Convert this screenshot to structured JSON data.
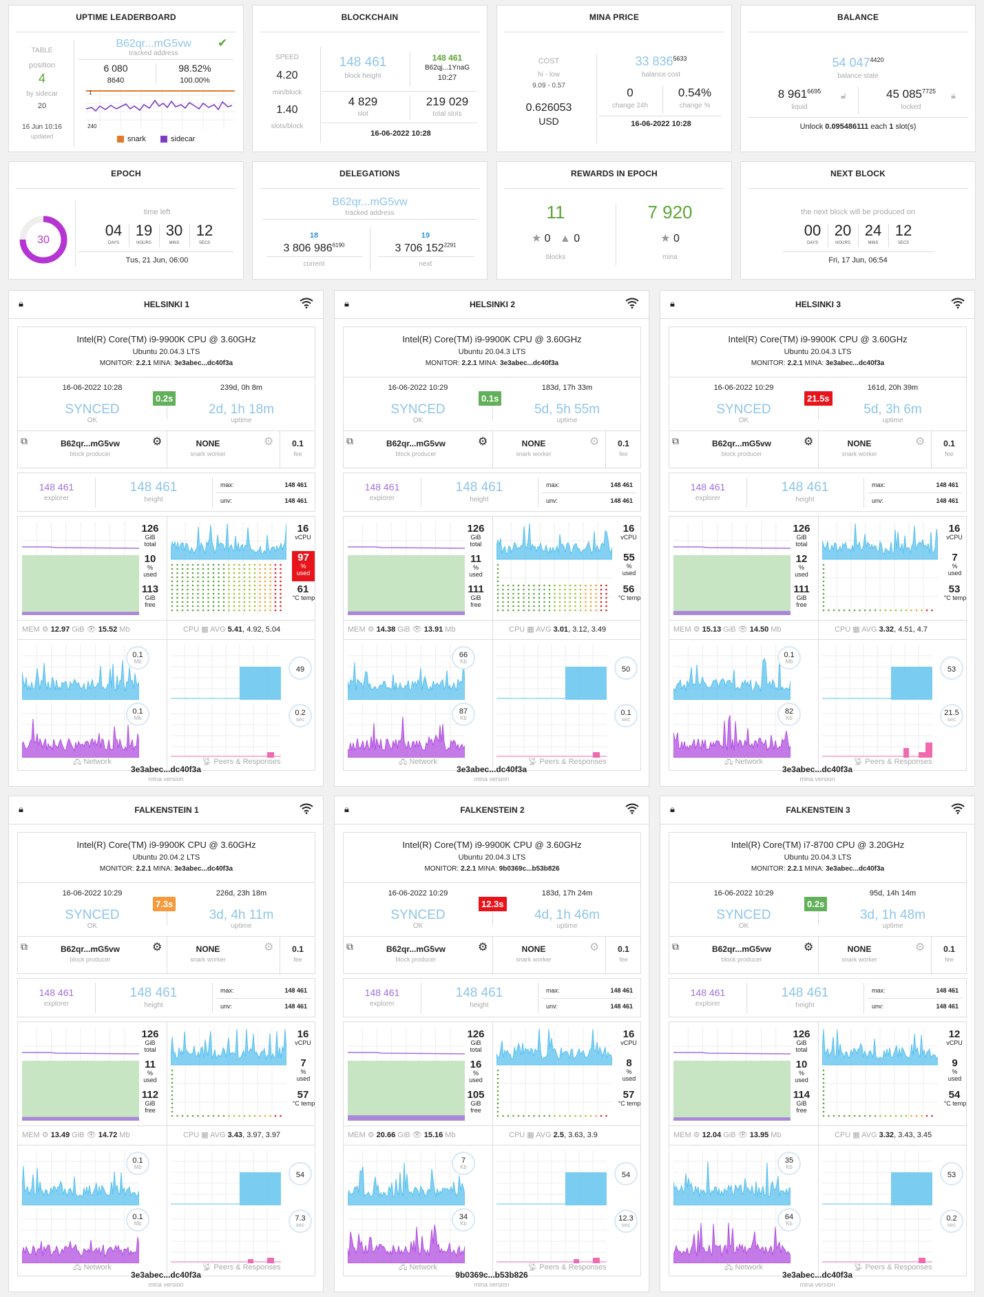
{
  "colors": {
    "accent_blue": "#8ec5ea",
    "green": "#5ba437",
    "purple": "#a36fe0",
    "red": "#e8141b",
    "orange": "#f59a3c",
    "badge_green": "#62b05a",
    "mem_fill": "#c7e5c2",
    "cpu_line": "#59c0ee"
  },
  "uptime": {
    "title": "UPTIME LEADERBOARD",
    "table_label": "TABLE",
    "position_label": "position",
    "position": "4",
    "by_sidecar_label": "by sidecar",
    "by_sidecar": "20",
    "date": "16 Jun 10:16",
    "updated_label": "updated",
    "address": "B62qr...mG5vw",
    "tracked_label": "tracked address",
    "score1": "6 080",
    "score2": "8640",
    "pct1": "98.52%",
    "pct2": "100.00%",
    "axis_top": "1",
    "axis_bottom": "240",
    "legend_snark": "snark",
    "legend_sidecar": "sidecar"
  },
  "blockchain": {
    "title": "BLOCKCHAIN",
    "speed_label": "SPEED",
    "speed1": "4.20",
    "speed1_unit": "min/block",
    "speed2": "1.40",
    "speed2_unit": "slots/block",
    "height": "148 461",
    "height_label": "block height",
    "latest_height": "148 461",
    "latest_hash": "B62qj...1YnaG",
    "latest_time": "10:27",
    "slot": "4 829",
    "slot_label": "slot",
    "total_slots": "219 029",
    "total_slots_label": "total slots",
    "date": "16-06-2022 10:28"
  },
  "price": {
    "title": "MINA PRICE",
    "cost_label": "COST",
    "hilo_label": "hi - low",
    "hilo": "9.09 - 0.57",
    "price": "0.626053",
    "currency": "USD",
    "balance_cost": "33 836",
    "balance_cost_sup": "5633",
    "balance_cost_label": "balance cost",
    "change": "0",
    "change_label": "change 24h",
    "change_pct": "0.54%",
    "change_pct_label": "change %",
    "date": "16-06-2022 10:28"
  },
  "balance": {
    "title": "BALANCE",
    "state": "54 047",
    "state_sup": "4420",
    "state_label": "balance state",
    "liquid": "8 961",
    "liquid_sup": "6695",
    "liquid_label": "liquid",
    "locked": "45 085",
    "locked_sup": "7725",
    "locked_label": "locked",
    "unlock_prefix": "Unlock",
    "unlock_amount": "0.095486111",
    "unlock_mid": "each",
    "unlock_slots": "1",
    "unlock_suffix": "slot(s)"
  },
  "epoch": {
    "title": "EPOCH",
    "number": "30",
    "time_left_label": "time left",
    "progress": 0.25,
    "days": "04",
    "hours": "19",
    "mins": "30",
    "secs": "12",
    "days_l": "DAYS",
    "hours_l": "HOURS",
    "mins_l": "MINS",
    "secs_l": "SECS",
    "date": "Tus, 21 Jun, 06:00"
  },
  "delegations": {
    "title": "DELEGATIONS",
    "address": "B62qr...mG5vw",
    "tracked_label": "tracked address",
    "current_count": "18",
    "current": "3 806 986",
    "current_sup": "6190",
    "current_label": "current",
    "next_count": "19",
    "next": "3 706 152",
    "next_sup": "2291",
    "next_label": "next"
  },
  "rewards": {
    "title": "REWARDS IN EPOCH",
    "blocks": "11",
    "blocks_star": "0",
    "blocks_orphan": "0",
    "blocks_label": "blocks",
    "mina": "7 920",
    "mina_star": "0",
    "mina_label": "mina"
  },
  "nextblock": {
    "title": "NEXT BLOCK",
    "subtitle": "the next block will be produced on",
    "days": "00",
    "hours": "20",
    "mins": "24",
    "secs": "12",
    "days_l": "DAYS",
    "hours_l": "HOURS",
    "mins_l": "MINS",
    "secs_l": "SECS",
    "date": "Fri, 17 Jun, 06:54"
  },
  "labels": {
    "ok": "OK",
    "uptime": "uptime",
    "block_producer": "block producer",
    "snark_worker": "snark worker",
    "fee": "fee",
    "explorer": "explorer",
    "height": "height",
    "max": "max:",
    "unv": "unv:",
    "total": "total",
    "used": "used",
    "free": "free",
    "gib": "GiB",
    "pct": "%",
    "vcpu": "vCPU",
    "temp": "°C temp",
    "mem": "MEM",
    "mb": "Mb",
    "cpu": "CPU",
    "avg": "AVG",
    "network": "Network",
    "peers": "Peers & Responses",
    "mina_version": "mina version",
    "monitor": "MONITOR:",
    "mina": "MINA:",
    "sec": "sec",
    "kb": "Kb"
  },
  "nodes": [
    {
      "name": "HELSINKI 1",
      "cpu": "Intel(R) Core(TM) i9-9900K CPU @ 3.60GHz",
      "os": "Ubuntu 20.04.3 LTS",
      "monitor": "2.2.1",
      "mina": "3e3abec...dc40f3a",
      "date": "16-06-2022 10:28",
      "latency": "0.2s",
      "latency_color": "#62b05a",
      "server_uptime": "239d, 0h 8m",
      "status": "SYNCED",
      "uptime": "2d, 1h 18m",
      "producer": "B62qr...mG5vw",
      "snark": "NONE",
      "fee": "0.1",
      "explorer": "148 461",
      "height": "148 461",
      "max": "148 461",
      "unv": "148 461",
      "mem_total": "126",
      "mem_used": "10",
      "mem_free": "113",
      "vcpu": "16",
      "cpu_used": "97",
      "cpu_used_alert": true,
      "temp": "61",
      "mem_gib": "12.97",
      "mem_mb": "15.52",
      "avg1": "5.41",
      "avg_rest": "4.92, 5.04",
      "net_in": "0.1",
      "net_in_unit": "Mb",
      "net_out": "0.1",
      "net_out_unit": "Mb",
      "peers": "49",
      "resp": "0.2",
      "version": "3e3abec...dc40f3a",
      "cpu_lvl": 1.0,
      "mem_lvl": 0.08
    },
    {
      "name": "HELSINKI 2",
      "cpu": "Intel(R) Core(TM) i9-9900K CPU @ 3.60GHz",
      "os": "Ubuntu 20.04.3 LTS",
      "monitor": "2.2.1",
      "mina": "3e3abec...dc40f3a",
      "date": "16-06-2022 10:29",
      "latency": "0.1s",
      "latency_color": "#62b05a",
      "server_uptime": "183d, 17h 33m",
      "status": "SYNCED",
      "uptime": "5d, 5h 55m",
      "producer": "B62qr...mG5vw",
      "snark": "NONE",
      "fee": "0.1",
      "explorer": "148 461",
      "height": "148 461",
      "max": "148 461",
      "unv": "148 461",
      "mem_total": "126",
      "mem_used": "11",
      "mem_free": "111",
      "vcpu": "16",
      "cpu_used": "55",
      "cpu_used_alert": false,
      "temp": "56",
      "mem_gib": "14.38",
      "mem_mb": "13.91",
      "avg1": "3.01",
      "avg_rest": "3.12, 3.49",
      "net_in": "66",
      "net_in_unit": "Kb",
      "net_out": "87",
      "net_out_unit": "Kb",
      "peers": "50",
      "resp": "0.1",
      "version": "3e3abec...dc40f3a",
      "cpu_lvl": 0.55,
      "mem_lvl": 0.09
    },
    {
      "name": "HELSINKI 3",
      "cpu": "Intel(R) Core(TM) i9-9900K CPU @ 3.60GHz",
      "os": "Ubuntu 20.04.3 LTS",
      "monitor": "2.2.1",
      "mina": "3e3abec...dc40f3a",
      "date": "16-06-2022 10:29",
      "latency": "21.5s",
      "latency_color": "#e8141b",
      "server_uptime": "161d, 20h 39m",
      "status": "SYNCED",
      "uptime": "5d, 3h 6m",
      "producer": "B62qr...mG5vw",
      "snark": "NONE",
      "fee": "0.1",
      "explorer": "148 461",
      "height": "148 461",
      "max": "148 461",
      "unv": "148 461",
      "mem_total": "126",
      "mem_used": "12",
      "mem_free": "111",
      "vcpu": "16",
      "cpu_used": "7",
      "cpu_used_alert": false,
      "temp": "53",
      "mem_gib": "15.13",
      "mem_mb": "14.50",
      "avg1": "3.32",
      "avg_rest": "4.51, 4.7",
      "net_in": "0.1",
      "net_in_unit": "Mb",
      "net_out": "82",
      "net_out_unit": "Kb",
      "peers": "53",
      "resp": "21.5",
      "version": "3e3abec...dc40f3a",
      "cpu_lvl": 0.07,
      "mem_lvl": 0.1
    },
    {
      "name": "FALKENSTEIN 1",
      "cpu": "Intel(R) Core(TM) i9-9900K CPU @ 3.60GHz",
      "os": "Ubuntu 20.04.2 LTS",
      "monitor": "2.2.1",
      "mina": "3e3abec...dc40f3a",
      "date": "16-06-2022 10:29",
      "latency": "7.3s",
      "latency_color": "#f59a3c",
      "server_uptime": "226d, 23h 18m",
      "status": "SYNCED",
      "uptime": "3d, 4h 11m",
      "producer": "B62qr...mG5vw",
      "snark": "NONE",
      "fee": "0.1",
      "explorer": "148 461",
      "height": "148 461",
      "max": "148 461",
      "unv": "148 461",
      "mem_total": "126",
      "mem_used": "11",
      "mem_free": "112",
      "vcpu": "16",
      "cpu_used": "7",
      "cpu_used_alert": false,
      "temp": "57",
      "mem_gib": "13.49",
      "mem_mb": "14.72",
      "avg1": "3.43",
      "avg_rest": "3.97, 3.97",
      "net_in": "0.1",
      "net_in_unit": "Mb",
      "net_out": "0.1",
      "net_out_unit": "Mb",
      "peers": "54",
      "resp": "7.3",
      "version": "3e3abec...dc40f3a",
      "cpu_lvl": 0.07,
      "mem_lvl": 0.09
    },
    {
      "name": "FALKENSTEIN 2",
      "cpu": "Intel(R) Core(TM) i9-9900K CPU @ 3.60GHz",
      "os": "Ubuntu 20.04.3 LTS",
      "monitor": "2.2.1",
      "mina": "9b0369c...b53b826",
      "date": "16-06-2022 10:29",
      "latency": "12.3s",
      "latency_color": "#e8141b",
      "server_uptime": "183d, 17h 24m",
      "status": "SYNCED",
      "uptime": "4d, 1h 46m",
      "producer": "B62qr...mG5vw",
      "snark": "NONE",
      "fee": "0.1",
      "explorer": "148 461",
      "height": "148 461",
      "max": "148 461",
      "unv": "148 461",
      "mem_total": "126",
      "mem_used": "16",
      "mem_free": "105",
      "vcpu": "16",
      "cpu_used": "8",
      "cpu_used_alert": false,
      "temp": "57",
      "mem_gib": "20.66",
      "mem_mb": "15.16",
      "avg1": "2.5",
      "avg_rest": "3.63, 3.9",
      "net_in": "7",
      "net_in_unit": "Kb",
      "net_out": "34",
      "net_out_unit": "Kb",
      "peers": "54",
      "resp": "12.3",
      "version": "9b0369c...b53b826",
      "cpu_lvl": 0.08,
      "mem_lvl": 0.13
    },
    {
      "name": "FALKENSTEIN 3",
      "cpu": "Intel(R) Core(TM) i7-8700 CPU @ 3.20GHz",
      "os": "Ubuntu 20.04.3 LTS",
      "monitor": "2.2.1",
      "mina": "3e3abec...dc40f3a",
      "date": "16-06-2022 10:29",
      "latency": "0.2s",
      "latency_color": "#62b05a",
      "server_uptime": "95d, 14h 14m",
      "status": "SYNCED",
      "uptime": "3d, 1h 48m",
      "producer": "B62qr...mG5vw",
      "snark": "NONE",
      "fee": "0.1",
      "explorer": "148 461",
      "height": "148 461",
      "max": "148 461",
      "unv": "148 461",
      "mem_total": "126",
      "mem_used": "10",
      "mem_free": "114",
      "vcpu": "12",
      "cpu_used": "9",
      "cpu_used_alert": false,
      "temp": "54",
      "mem_gib": "12.04",
      "mem_mb": "13.95",
      "avg1": "3.32",
      "avg_rest": "3.43, 3.45",
      "net_in": "35",
      "net_in_unit": "Kb",
      "net_out": "64",
      "net_out_unit": "Kb",
      "peers": "53",
      "resp": "0.2",
      "version": "3e3abec...dc40f3a",
      "cpu_lvl": 0.09,
      "mem_lvl": 0.08
    }
  ]
}
